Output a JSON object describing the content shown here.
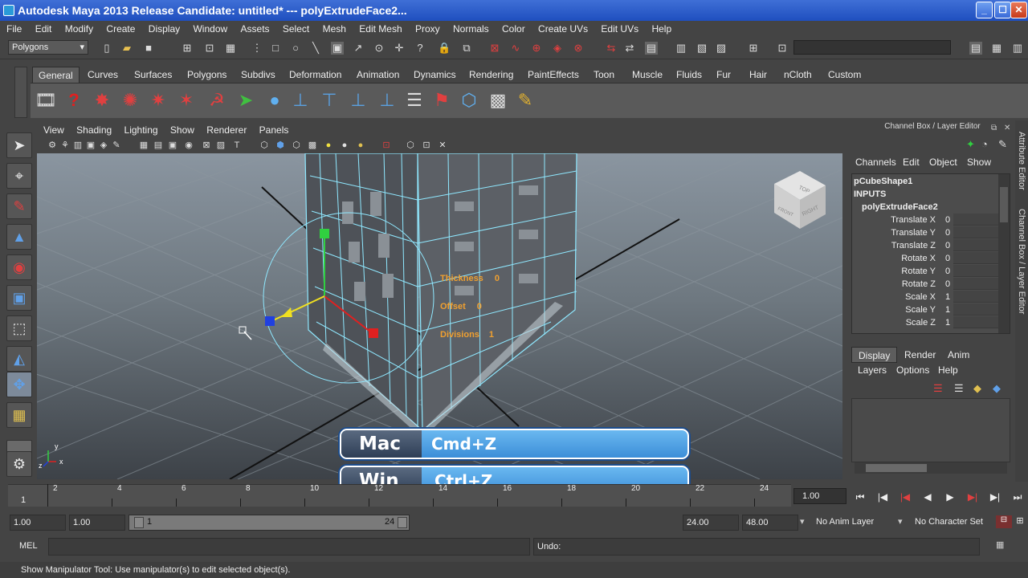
{
  "window": {
    "title": "Autodesk Maya 2013 Release Candidate: untitled*   ---   polyExtrudeFace2...",
    "min": "_",
    "max": "☐",
    "close": "✕"
  },
  "menus": [
    "File",
    "Edit",
    "Modify",
    "Create",
    "Display",
    "Window",
    "Assets",
    "Select",
    "Mesh",
    "Edit Mesh",
    "Proxy",
    "Normals",
    "Color",
    "Create UVs",
    "Edit UVs",
    "Help"
  ],
  "mode_selector": "Polygons",
  "shelf_tabs": [
    "General",
    "Curves",
    "Surfaces",
    "Polygons",
    "Subdivs",
    "Deformation",
    "Animation",
    "Dynamics",
    "Rendering",
    "PaintEffects",
    "Toon",
    "Muscle",
    "Fluids",
    "Fur",
    "Hair",
    "nCloth",
    "Custom"
  ],
  "viewport": {
    "menus": [
      "View",
      "Shading",
      "Lighting",
      "Show",
      "Renderer",
      "Panels"
    ],
    "hud": {
      "thickness_label": "Thickness",
      "thickness_value": "0",
      "offset_label": "Offset",
      "offset_value": "0",
      "divisions_label": "Divisions",
      "divisions_value": "1"
    },
    "viewcube": {
      "top": "TOP",
      "front": "FRONT",
      "right": "RIGHT"
    },
    "axis": {
      "x": "x",
      "y": "y",
      "z": "z"
    }
  },
  "overlay": {
    "mac_label": "Mac",
    "mac_keys": "Cmd+Z",
    "win_label": "Win",
    "win_keys": "Ctrl+Z"
  },
  "channel_box": {
    "title": "Channel Box / Layer Editor",
    "menus": [
      "Channels",
      "Edit",
      "Object",
      "Show"
    ],
    "object": "pCubeShape1",
    "inputs": "INPUTS",
    "node": "polyExtrudeFace2",
    "attributes": [
      {
        "name": "Translate X",
        "value": "0"
      },
      {
        "name": "Translate Y",
        "value": "0"
      },
      {
        "name": "Translate Z",
        "value": "0"
      },
      {
        "name": "Rotate X",
        "value": "0"
      },
      {
        "name": "Rotate Y",
        "value": "0"
      },
      {
        "name": "Rotate Z",
        "value": "0"
      },
      {
        "name": "Scale X",
        "value": "1"
      },
      {
        "name": "Scale Y",
        "value": "1"
      },
      {
        "name": "Scale Z",
        "value": "1"
      }
    ]
  },
  "layer_editor": {
    "tabs": [
      "Display",
      "Render",
      "Anim"
    ],
    "menus": [
      "Layers",
      "Options",
      "Help"
    ]
  },
  "side_tabs": [
    "Attribute Editor",
    "Channel Box / Layer Editor"
  ],
  "timeline": {
    "start_label": "1",
    "ticks": [
      "2",
      "4",
      "6",
      "8",
      "10",
      "12",
      "14",
      "16",
      "18",
      "20",
      "22",
      "24"
    ],
    "current_frame": "1.00"
  },
  "range": {
    "start": "1.00",
    "playback_start": "1.00",
    "slider_start": "1",
    "slider_end": "24",
    "playback_end": "24.00",
    "end": "48.00",
    "anim_layer": "No Anim Layer",
    "character_set": "No Character Set"
  },
  "command": {
    "mel_label": "MEL",
    "result_label": "Undo:"
  },
  "help_line": "Show Manipulator Tool: Use manipulator(s) to edit selected object(s)."
}
